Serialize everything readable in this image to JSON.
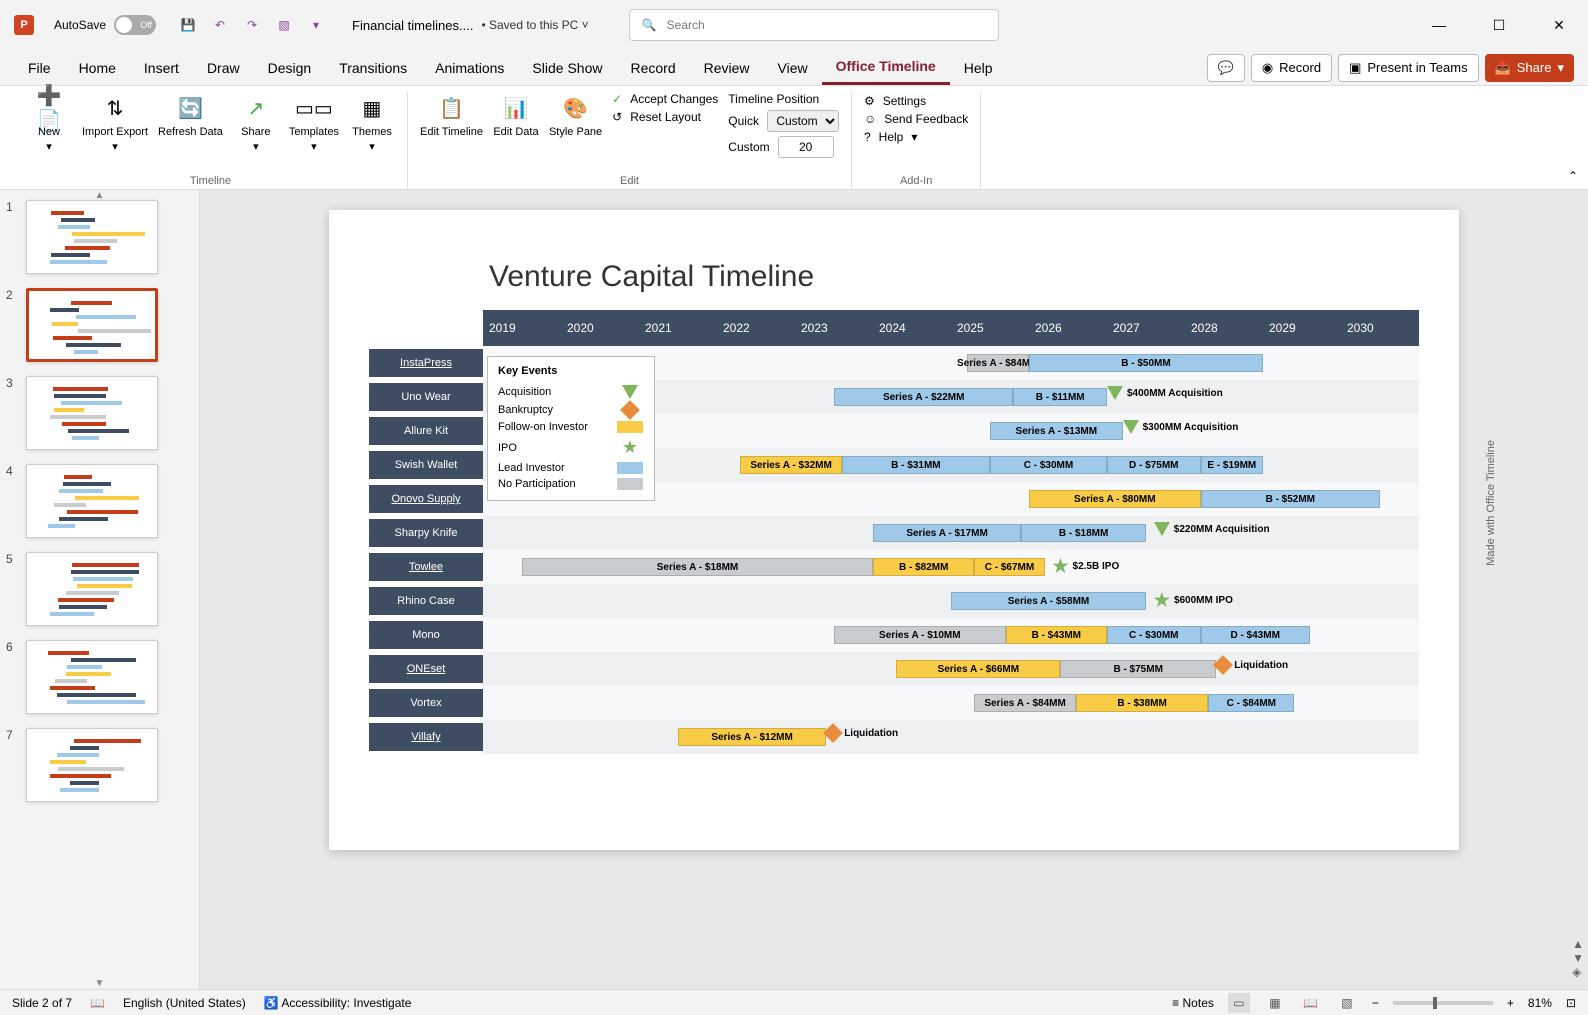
{
  "titlebar": {
    "autosave_label": "AutoSave",
    "autosave_state": "Off",
    "filename": "Financial timelines....",
    "saved_status": "• Saved to this PC ˅",
    "search_placeholder": "Search"
  },
  "tabs": {
    "file": "File",
    "home": "Home",
    "insert": "Insert",
    "draw": "Draw",
    "design": "Design",
    "transitions": "Transitions",
    "animations": "Animations",
    "slideshow": "Slide Show",
    "record": "Record",
    "review": "Review",
    "view": "View",
    "office_timeline": "Office Timeline",
    "help": "Help"
  },
  "ribbon_right": {
    "comments": "💬",
    "record": "Record",
    "present": "Present in Teams",
    "share": "Share"
  },
  "ribbon": {
    "group1_label": "Timeline",
    "new": "New",
    "import": "Import\nExport",
    "refresh": "Refresh\nData",
    "share": "Share",
    "templates": "Templates",
    "themes": "Themes",
    "group2_label": "Edit",
    "edit_timeline": "Edit\nTimeline",
    "edit_data": "Edit\nData",
    "style_pane": "Style\nPane",
    "accept": "Accept Changes",
    "reset": "Reset Layout",
    "pos_label": "Timeline Position",
    "quick": "Quick",
    "quick_val": "Custom",
    "custom": "Custom",
    "custom_val": "20",
    "group3_label": "Add-In",
    "settings": "Settings",
    "feedback": "Send Feedback",
    "help": "Help"
  },
  "thumbs": {
    "count": 7,
    "active": 2
  },
  "slide": {
    "title": "Venture Capital Timeline",
    "watermark": "Made with        Office Timeline"
  },
  "chart_data": {
    "type": "bar",
    "xlabel": "",
    "ylabel": "",
    "years": [
      "2019",
      "2020",
      "2021",
      "2022",
      "2023",
      "2024",
      "2025",
      "2026",
      "2027",
      "2028",
      "2029",
      "2030"
    ],
    "legend_title": "Key Events",
    "legend": [
      {
        "label": "Acquisition",
        "shape": "tri-down"
      },
      {
        "label": "Bankruptcy",
        "shape": "diamond"
      },
      {
        "label": "Follow-on Investor",
        "shape": "yellow"
      },
      {
        "label": "IPO",
        "shape": "star"
      },
      {
        "label": "Lead Investor",
        "shape": "blue"
      },
      {
        "label": "No Participation",
        "shape": "grey"
      }
    ],
    "rows": [
      {
        "name": "InstaPress",
        "underline": true,
        "bars": [
          {
            "label": "Series A - $84MM",
            "start": 2025.2,
            "end": 2026.0,
            "color": "grey"
          },
          {
            "label": "B - $50MM",
            "start": 2026.0,
            "end": 2029.0,
            "color": "blue"
          }
        ],
        "events": []
      },
      {
        "name": "Uno Wear",
        "bars": [
          {
            "label": "Series A - $22MM",
            "start": 2023.5,
            "end": 2025.8,
            "color": "blue"
          },
          {
            "label": "B - $11MM",
            "start": 2025.8,
            "end": 2027.0,
            "color": "blue"
          }
        ],
        "events": [
          {
            "label": "$400MM Acquisition",
            "at": 2027.0,
            "shape": "tri-down"
          }
        ]
      },
      {
        "name": "Allure Kit",
        "bars": [
          {
            "label": "Series A - $13MM",
            "start": 2025.5,
            "end": 2027.2,
            "color": "blue"
          }
        ],
        "events": [
          {
            "label": "$300MM Acquisition",
            "at": 2027.2,
            "shape": "tri-down"
          }
        ]
      },
      {
        "name": "Swish Wallet",
        "bars": [
          {
            "label": "Series A - $32MM",
            "start": 2022.3,
            "end": 2023.6,
            "color": "yellow"
          },
          {
            "label": "B - $31MM",
            "start": 2023.6,
            "end": 2025.5,
            "color": "blue"
          },
          {
            "label": "C - $30MM",
            "start": 2025.5,
            "end": 2027.0,
            "color": "blue"
          },
          {
            "label": "D - $75MM",
            "start": 2027.0,
            "end": 2028.2,
            "color": "blue"
          },
          {
            "label": "E - $19MM",
            "start": 2028.2,
            "end": 2029.0,
            "color": "blue"
          }
        ],
        "events": []
      },
      {
        "name": "Onovo Supply",
        "underline": true,
        "bars": [
          {
            "label": "Series A - $80MM",
            "start": 2026.0,
            "end": 2028.2,
            "color": "yellow"
          },
          {
            "label": "B - $52MM",
            "start": 2028.2,
            "end": 2030.5,
            "color": "blue"
          }
        ],
        "events": []
      },
      {
        "name": "Sharpy Knife",
        "bars": [
          {
            "label": "Series A - $17MM",
            "start": 2024.0,
            "end": 2025.9,
            "color": "blue"
          },
          {
            "label": "B - $18MM",
            "start": 2025.9,
            "end": 2027.5,
            "color": "blue"
          }
        ],
        "events": [
          {
            "label": "$220MM Acquisition",
            "at": 2027.6,
            "shape": "tri-down"
          }
        ]
      },
      {
        "name": "Towlee",
        "underline": true,
        "bars": [
          {
            "label": "Series A - $18MM",
            "start": 2019.5,
            "end": 2024.0,
            "color": "grey"
          },
          {
            "label": "B - $82MM",
            "start": 2024.0,
            "end": 2025.3,
            "color": "yellow"
          },
          {
            "label": "C - $67MM",
            "start": 2025.3,
            "end": 2026.2,
            "color": "yellow"
          }
        ],
        "events": [
          {
            "label": "$2.5B IPO",
            "at": 2026.3,
            "shape": "star"
          }
        ]
      },
      {
        "name": "Rhino Case",
        "bars": [
          {
            "label": "Series A - $58MM",
            "start": 2025.0,
            "end": 2027.5,
            "color": "blue"
          }
        ],
        "events": [
          {
            "label": "$600MM IPO",
            "at": 2027.6,
            "shape": "star"
          }
        ]
      },
      {
        "name": "Mono",
        "bars": [
          {
            "label": "Series A - $10MM",
            "start": 2023.5,
            "end": 2025.7,
            "color": "grey"
          },
          {
            "label": "B - $43MM",
            "start": 2025.7,
            "end": 2027.0,
            "color": "yellow"
          },
          {
            "label": "C - $30MM",
            "start": 2027.0,
            "end": 2028.2,
            "color": "blue"
          },
          {
            "label": "D - $43MM",
            "start": 2028.2,
            "end": 2029.6,
            "color": "blue"
          }
        ],
        "events": []
      },
      {
        "name": "ONEset",
        "underline": true,
        "bars": [
          {
            "label": "Series A - $66MM",
            "start": 2024.3,
            "end": 2026.4,
            "color": "yellow"
          },
          {
            "label": "B - $75MM",
            "start": 2026.4,
            "end": 2028.4,
            "color": "grey"
          }
        ],
        "events": [
          {
            "label": "Liquidation",
            "at": 2028.4,
            "shape": "diamond"
          }
        ]
      },
      {
        "name": "Vortex",
        "bars": [
          {
            "label": "Series A - $84MM",
            "start": 2025.3,
            "end": 2026.6,
            "color": "grey"
          },
          {
            "label": "B - $38MM",
            "start": 2026.6,
            "end": 2028.3,
            "color": "yellow"
          },
          {
            "label": "C - $84MM",
            "start": 2028.3,
            "end": 2029.4,
            "color": "blue"
          }
        ],
        "events": []
      },
      {
        "name": "Villafy",
        "underline": true,
        "bars": [
          {
            "label": "Series A - $12MM",
            "start": 2021.5,
            "end": 2023.4,
            "color": "yellow"
          }
        ],
        "events": [
          {
            "label": "Liquidation",
            "at": 2023.4,
            "shape": "diamond"
          }
        ]
      }
    ]
  },
  "status": {
    "slide": "Slide 2 of 7",
    "lang": "English (United States)",
    "access": "Accessibility: Investigate",
    "notes": "Notes",
    "zoom": "81%"
  }
}
